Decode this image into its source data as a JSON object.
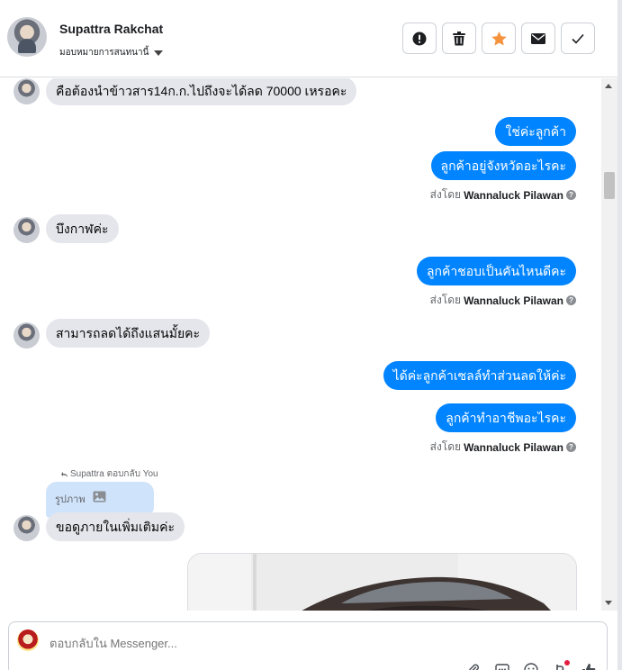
{
  "header": {
    "contact_name": "Supattra Rakchat",
    "assign_label": "มอบหมายการสนทนานี้"
  },
  "actions": [
    {
      "name": "mark-spam-button",
      "icon": "exclamation-icon"
    },
    {
      "name": "delete-button",
      "icon": "trash-icon"
    },
    {
      "name": "star-button",
      "icon": "star-icon",
      "color": "#f5923e"
    },
    {
      "name": "email-button",
      "icon": "envelope-icon"
    },
    {
      "name": "done-button",
      "icon": "check-icon"
    }
  ],
  "messages": {
    "m1": "คือต้องนำข้าวสาร14ก.ก.ไปถึงจะได้ลด 70000 เหรอคะ",
    "m2": "ใช่ค่ะลูกค้า",
    "m3": "ลูกค้าอยู่จังหวัดอะไรคะ",
    "m4": "บึงกาฬค่ะ",
    "m5": "ลูกค้าชอบเป็นคันไหนดีคะ",
    "m6": "สามารถลดได้ถึงแสนมั้ยคะ",
    "m7": "ได้ค่ะลูกค้าเซลล์ทำส่วนลดให้ค่ะ",
    "m8": "ลูกค้าทำอาชีพอะไรคะ",
    "m9": "ขอดูภายในเพิ่มเติมค่ะ"
  },
  "sent_by": {
    "prefix": "ส่งโดย",
    "agent": "Wannaluck Pilawan"
  },
  "reply": {
    "note": "Supattra ตอบกลับ You",
    "label": "รูปภาพ"
  },
  "composer": {
    "placeholder": "ตอบกลับใน Messenger..."
  },
  "colors": {
    "outgoing_bubble": "#0084ff",
    "incoming_bubble": "#e4e6eb",
    "reply_bubble": "#cfe3fb",
    "notification_dot": "#e41e3f"
  }
}
